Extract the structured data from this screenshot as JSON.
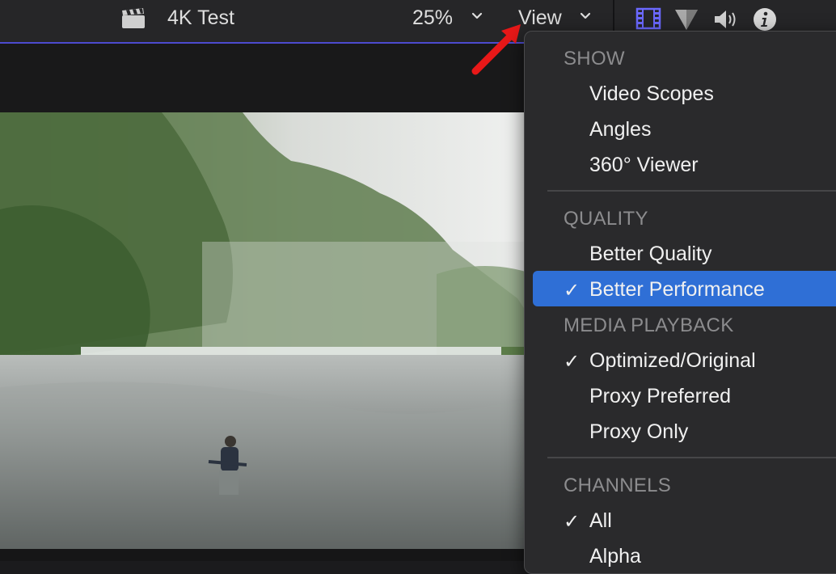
{
  "toolbar": {
    "project_title": "4K Test",
    "zoom_label": "25%",
    "view_label": "View"
  },
  "menu": {
    "show_header": "SHOW",
    "show_items": [
      "Video Scopes",
      "Angles",
      "360° Viewer"
    ],
    "quality_header": "QUALITY",
    "quality_items": [
      "Better Quality",
      "Better Performance"
    ],
    "quality_selected": "Better Performance",
    "playback_header": "MEDIA PLAYBACK",
    "playback_items": [
      "Optimized/Original",
      "Proxy Preferred",
      "Proxy Only"
    ],
    "playback_selected": "Optimized/Original",
    "channels_header": "CHANNELS",
    "channels_items": [
      "All",
      "Alpha"
    ],
    "channels_selected": "All",
    "check_glyph": "✓"
  },
  "colors": {
    "accent": "#4d4bcf",
    "highlight": "#2f6fd6",
    "arrow": "#e81818"
  }
}
